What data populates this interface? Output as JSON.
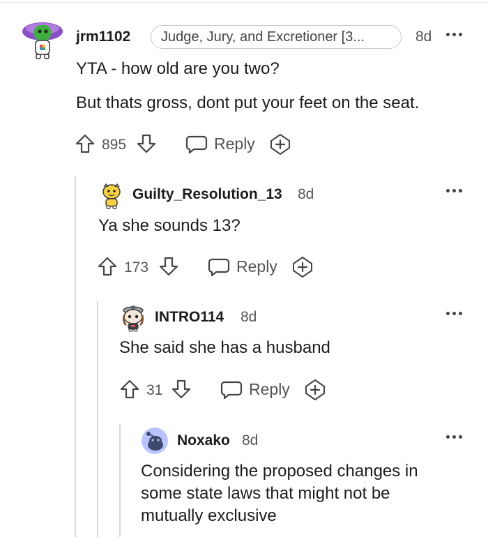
{
  "comments": [
    {
      "username": "jrm1102",
      "flair": "Judge, Jury, and Excretioner [3...",
      "time": "8d",
      "body": [
        "YTA - how old are you two?",
        "But thats gross, dont put your feet on the seat."
      ],
      "votes": "895",
      "reply_label": "Reply"
    },
    {
      "username": "Guilty_Resolution_13",
      "time": "8d",
      "body": [
        "Ya she sounds 13?"
      ],
      "votes": "173",
      "reply_label": "Reply"
    },
    {
      "username": "INTRO114",
      "time": "8d",
      "body": [
        "She said she has a husband"
      ],
      "votes": "31",
      "reply_label": "Reply"
    },
    {
      "username": "Noxako",
      "time": "8d",
      "body": [
        "Considering the proposed changes in",
        "some state laws that might not be",
        "mutually exclusive"
      ]
    }
  ],
  "icons": {
    "upvote": "upvote-arrow-icon",
    "downvote": "downvote-arrow-icon",
    "reply": "speech-bubble-icon",
    "award": "award-plus-icon",
    "more": "more-options-icon"
  },
  "colors": {
    "text": "#1c1c1c",
    "muted": "#555555",
    "thread_line": "#d9d9d9",
    "flair_border": "#c9c9c9"
  }
}
